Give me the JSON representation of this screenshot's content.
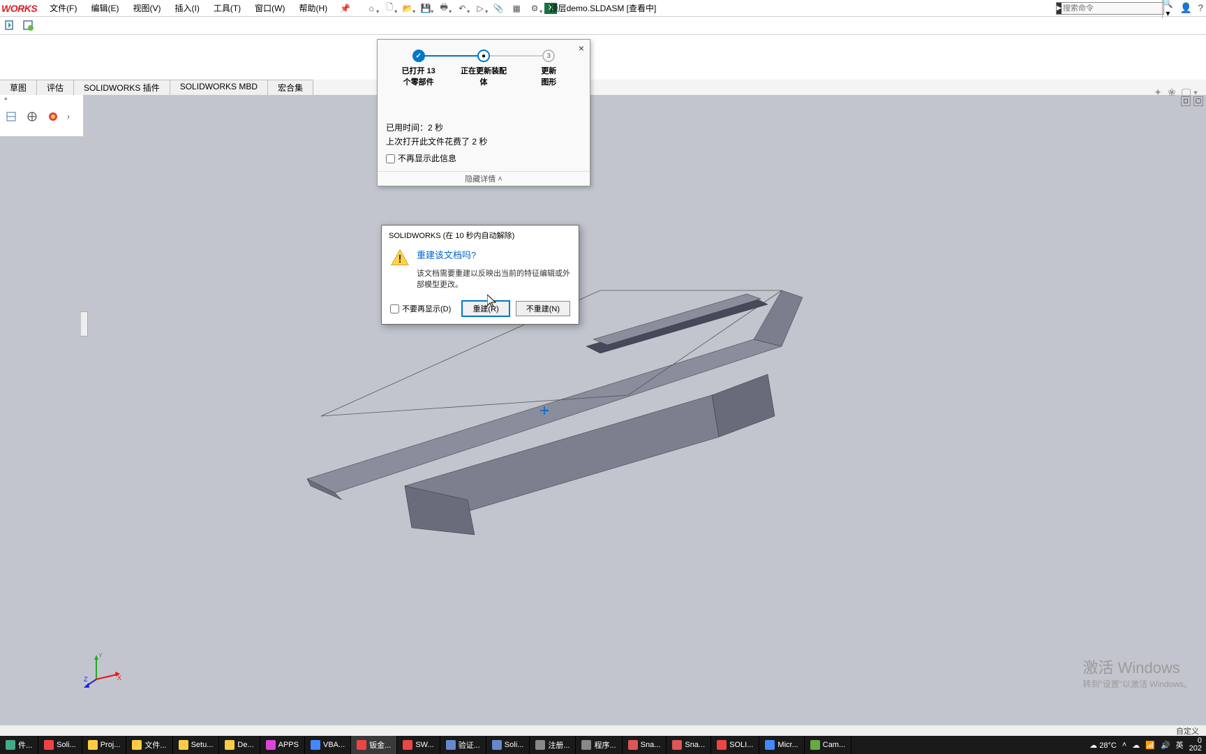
{
  "app": {
    "logo": "WORKS",
    "menus": [
      "文件(F)",
      "编辑(E)",
      "视图(V)",
      "插入(I)",
      "工具(T)",
      "窗口(W)",
      "帮助(H)"
    ],
    "doc_title": "顶层demo.SLDASM [查看中]",
    "search_placeholder": "搜索命令"
  },
  "tabs": [
    "草图",
    "评估",
    "SOLIDWORKS 插件",
    "SOLIDWORKS MBD",
    "宏合集"
  ],
  "side_tree": {
    "header_deg": "°"
  },
  "progress": {
    "step1": {
      "label1": "已打开 13",
      "label2": "个零部件"
    },
    "step2": {
      "label1": "正在更新装配",
      "label2": "体"
    },
    "step3": {
      "num": "3",
      "label1": "更新",
      "label2": "图形"
    },
    "elapsed": "已用时间：2 秒",
    "last_open": "上次打开此文件花费了 2 秒",
    "dont_show": "不再显示此信息",
    "hide_detail": "隐藏详情"
  },
  "modal": {
    "title": "SOLIDWORKS  (在 10 秒内自动解除)",
    "question": "重建该文档吗?",
    "detail": "该文档需要重建以反映出当前的特征编辑或外部模型更改。",
    "dont_show": "不要再显示(D)",
    "btn_rebuild": "重建(R)",
    "btn_no": "不重建(N)"
  },
  "watermark": {
    "l1": "激活 Windows",
    "l2": "转到\"设置\"以激活 Windows。"
  },
  "statusbar": {
    "custom": "自定义"
  },
  "taskbar": {
    "items": [
      {
        "label": "件...",
        "color": "#4a8"
      },
      {
        "label": "Soli...",
        "color": "#e44"
      },
      {
        "label": "Proj...",
        "color": "#fc4"
      },
      {
        "label": "文件...",
        "color": "#fc4"
      },
      {
        "label": "Setu...",
        "color": "#fc4"
      },
      {
        "label": "De...",
        "color": "#fc4"
      },
      {
        "label": "APPS",
        "color": "#d4d"
      },
      {
        "label": "VBA...",
        "color": "#48f"
      },
      {
        "label": "钣金...",
        "color": "#e44",
        "active": true
      },
      {
        "label": "SW...",
        "color": "#e44"
      },
      {
        "label": "验证...",
        "color": "#68c"
      },
      {
        "label": "Soli...",
        "color": "#68c"
      },
      {
        "label": "注册...",
        "color": "#888"
      },
      {
        "label": "程序...",
        "color": "#888"
      },
      {
        "label": "Sna...",
        "color": "#d55"
      },
      {
        "label": "Sna...",
        "color": "#d55"
      },
      {
        "label": "SOLI...",
        "color": "#e44"
      },
      {
        "label": "Micr...",
        "color": "#48f"
      },
      {
        "label": "Cam...",
        "color": "#6a4"
      }
    ],
    "weather": "28°C",
    "ime": "英",
    "time_suffix": "202",
    "time_prefix": "0"
  }
}
